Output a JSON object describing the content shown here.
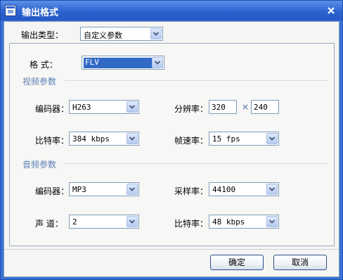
{
  "window": {
    "title": "输出格式"
  },
  "output_type": {
    "label": "输出类型：",
    "value": "自定义参数"
  },
  "format": {
    "label": "格  式：",
    "value": "FLV"
  },
  "video": {
    "section_title": "视频参数",
    "encoder": {
      "label": "编码器：",
      "value": "H263"
    },
    "resolution": {
      "label": "分辨率：",
      "width": "320",
      "separator": "×",
      "height": "240"
    },
    "bitrate": {
      "label": "比特率：",
      "value": "384 kbps"
    },
    "framerate": {
      "label": "帧速率：",
      "value": "15 fps"
    }
  },
  "audio": {
    "section_title": "音频参数",
    "encoder": {
      "label": "编码器：",
      "value": "MP3"
    },
    "samplerate": {
      "label": "采样率：",
      "value": "44100"
    },
    "channels": {
      "label": "声  道：",
      "value": "2"
    },
    "bitrate": {
      "label": "比特率：",
      "value": "48 kbps"
    }
  },
  "buttons": {
    "ok": "确定",
    "cancel": "取消"
  },
  "colors": {
    "titlebar": "#2c63cf",
    "section_text": "#5b7fb6",
    "selection": "#316ac5"
  },
  "icons": {
    "app": "app-window-icon",
    "close": "close-icon",
    "dropdown": "chevron-down-icon"
  }
}
